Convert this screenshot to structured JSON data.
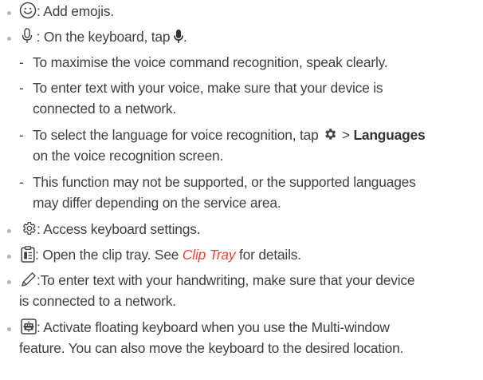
{
  "items": {
    "emoji": {
      "icon": "smiley-icon",
      "text": ": Add emojis."
    },
    "voice": {
      "icon": "microphone-outline-icon",
      "text": ": On the keyboard, tap",
      "icon2": "microphone-filled-icon",
      "text_end": ".",
      "subs": {
        "s1": "To maximise the voice command recognition, speak clearly.",
        "s2_l1": "To enter text with your voice, make sure that your device is",
        "s2_l2": "connected to a network.",
        "s3_pre": "To select the language for voice recognition, tap",
        "s3_icon": "gear-icon",
        "s3_gt": ">",
        "s3_bold": "Languages",
        "s3_l2": "on the voice recognition screen.",
        "s4_l1": "This function may not be supported, or the supported languages",
        "s4_l2": "may differ depending on the service area."
      }
    },
    "settings": {
      "icon": "settings-gear-outline-icon",
      "text": ": Access keyboard settings."
    },
    "clip": {
      "icon": "clip-tray-icon",
      "text_pre": ": Open the clip tray. See",
      "link": "Clip Tray",
      "text_post": "for details."
    },
    "handwriting": {
      "icon": "pen-icon",
      "l1": ":To enter text with your handwriting, make sure that your device",
      "l2": "is connected to a network."
    },
    "floating": {
      "icon": "floating-keyboard-icon",
      "l1": ": Activate floating keyboard when you use the Multi-window",
      "l2": "feature. You can also move the keyboard to the desired location."
    }
  },
  "colors": {
    "text": "#3f3f3f",
    "bullet": "#b5b5b5",
    "link": "#e8453c",
    "icon": "#444444"
  }
}
